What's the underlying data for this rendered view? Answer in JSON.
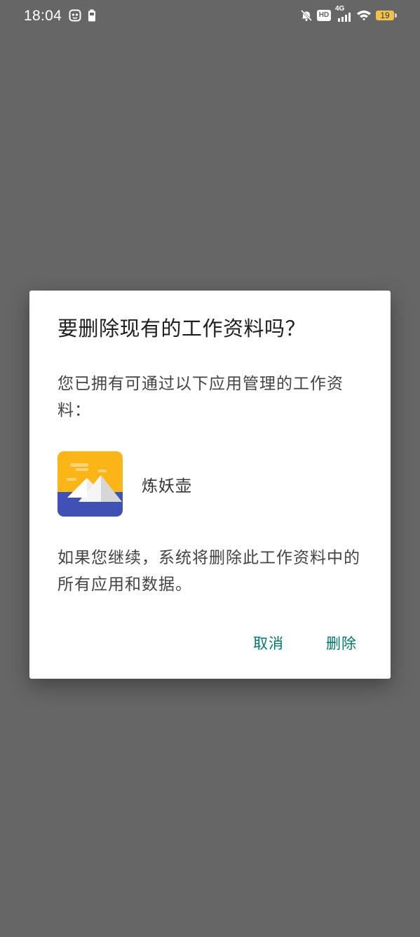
{
  "status_bar": {
    "time": "18:04",
    "left_icons": [
      "app-notification-icon",
      "battery-saver-icon"
    ],
    "right_icons": [
      "mute-icon",
      "hd-icon",
      "signal-4g-icon",
      "wifi-icon",
      "battery-icon"
    ],
    "hd_label": "HD",
    "network_label": "4G",
    "battery_level": "19",
    "battery_color": "#f1c24a"
  },
  "dialog": {
    "title": "要删除现有的工作资料吗？",
    "message": "您已拥有可通过以下应用管理的工作资料：",
    "app": {
      "name": "炼妖壶",
      "icon": "mountain-landscape-icon"
    },
    "warning": "如果您继续，系统将删除此工作资料中的所有应用和数据。",
    "cancel_label": "取消",
    "delete_label": "删除",
    "accent_color": "#00796b"
  }
}
